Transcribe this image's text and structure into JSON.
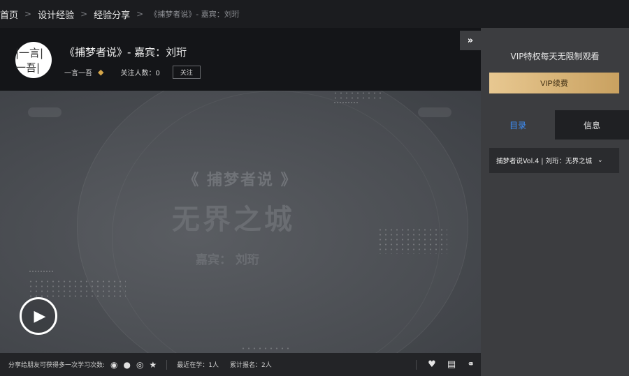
{
  "breadcrumb": {
    "items": [
      "首页",
      "设计经验",
      "经验分享"
    ],
    "current": "《捕梦者说》- 嘉宾：刘珩",
    "separator": ">"
  },
  "course": {
    "logo_text": "|一言|一吾|",
    "title": "《捕梦者说》- 嘉宾：刘珩",
    "author": "一言一吾",
    "follow_count": "关注人数：0",
    "follow_label": "关注"
  },
  "video": {
    "subtitle": "《 捕梦者说 》",
    "main_title": "无界之城",
    "guest": "嘉宾：  刘珩",
    "play_icon": "play-icon"
  },
  "bottom_bar": {
    "share_text": "分享给朋友可获得多一次学习次数:",
    "share_icons": [
      "wechat-icon",
      "qq-icon",
      "weibo-icon",
      "star-icon"
    ],
    "recent_learning": "最近在学：1人",
    "total_enrolled": "累计报名：2人",
    "action_icons": [
      "heart-icon",
      "comment-icon",
      "headset-icon"
    ]
  },
  "sidebar": {
    "collapse_label": "»",
    "vip_text": "VIP特权每天无限制观看",
    "vip_button": "VIP续费",
    "tabs": [
      {
        "label": "目录",
        "active": true
      },
      {
        "label": "信息",
        "active": false
      }
    ],
    "chapter": "捕梦者说Vol.4 | 刘珩：无界之城"
  },
  "colors": {
    "accent": "#3e8ef7",
    "vip_gold": "#d9b577",
    "diamond": "#d6a64a"
  }
}
